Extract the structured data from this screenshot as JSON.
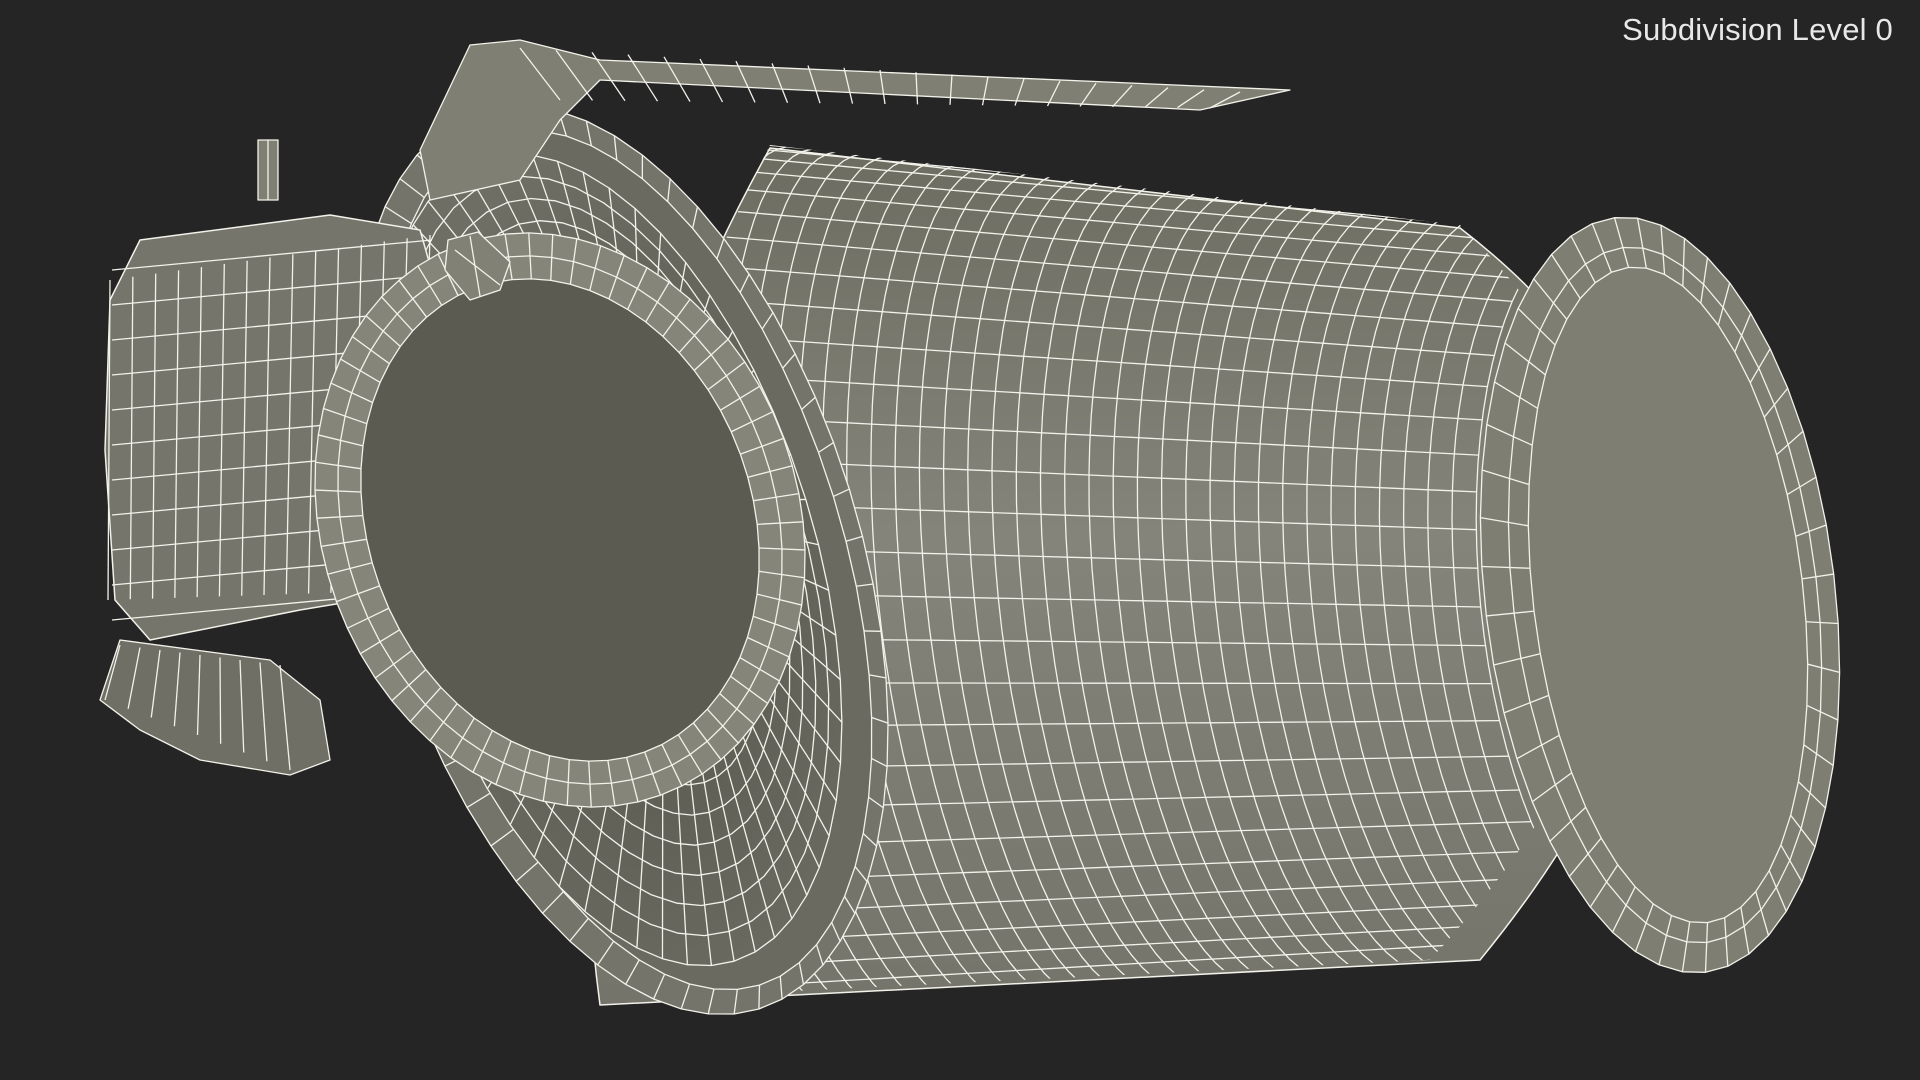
{
  "viewport": {
    "label": "Subdivision Level 0",
    "background": "#252525",
    "mesh_fill": "#7a7a6e",
    "wire_color": "#f2f2ea"
  }
}
